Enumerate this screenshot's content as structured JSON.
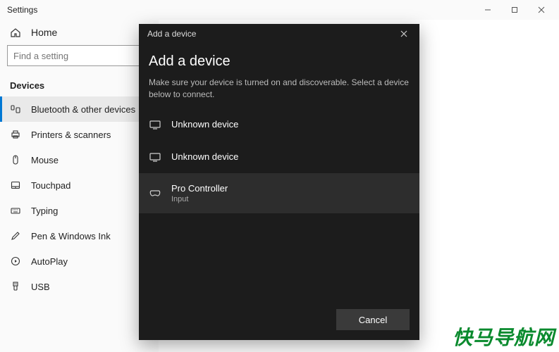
{
  "window": {
    "title": "Settings"
  },
  "sidebar": {
    "home": "Home",
    "search_placeholder": "Find a setting",
    "section": "Devices",
    "items": [
      {
        "label": "Bluetooth & other devices",
        "selected": true
      },
      {
        "label": "Printers & scanners",
        "selected": false
      },
      {
        "label": "Mouse",
        "selected": false
      },
      {
        "label": "Touchpad",
        "selected": false
      },
      {
        "label": "Typing",
        "selected": false
      },
      {
        "label": "Pen & Windows Ink",
        "selected": false
      },
      {
        "label": "AutoPlay",
        "selected": false
      },
      {
        "label": "USB",
        "selected": false
      }
    ]
  },
  "dialog": {
    "title": "Add a device",
    "heading": "Add a device",
    "subtext": "Make sure your device is turned on and discoverable. Select a device below to connect.",
    "devices": [
      {
        "title": "Unknown device",
        "subtitle": "",
        "selected": false,
        "kind": "display"
      },
      {
        "title": "Unknown device",
        "subtitle": "",
        "selected": false,
        "kind": "display"
      },
      {
        "title": "Pro Controller",
        "subtitle": "Input",
        "selected": true,
        "kind": "gamepad"
      }
    ],
    "cancel": "Cancel"
  },
  "watermark": "快马导航网"
}
